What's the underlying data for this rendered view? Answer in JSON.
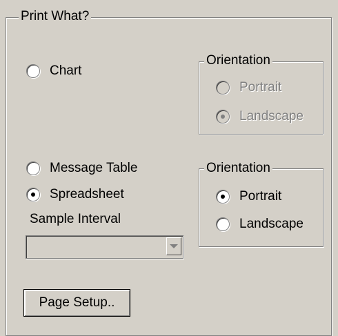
{
  "print_what": {
    "legend": "Print What?",
    "chart_label": "Chart",
    "message_table_label": "Message Table",
    "spreadsheet_label": "Spreadsheet",
    "sample_interval_label": "Sample Interval",
    "sample_interval_value": "",
    "page_setup_label": "Page Setup.."
  },
  "chart_orientation": {
    "legend": "Orientation",
    "portrait_label": "Portrait",
    "landscape_label": "Landscape"
  },
  "spreadsheet_orientation": {
    "legend": "Orientation",
    "portrait_label": "Portrait",
    "landscape_label": "Landscape"
  }
}
